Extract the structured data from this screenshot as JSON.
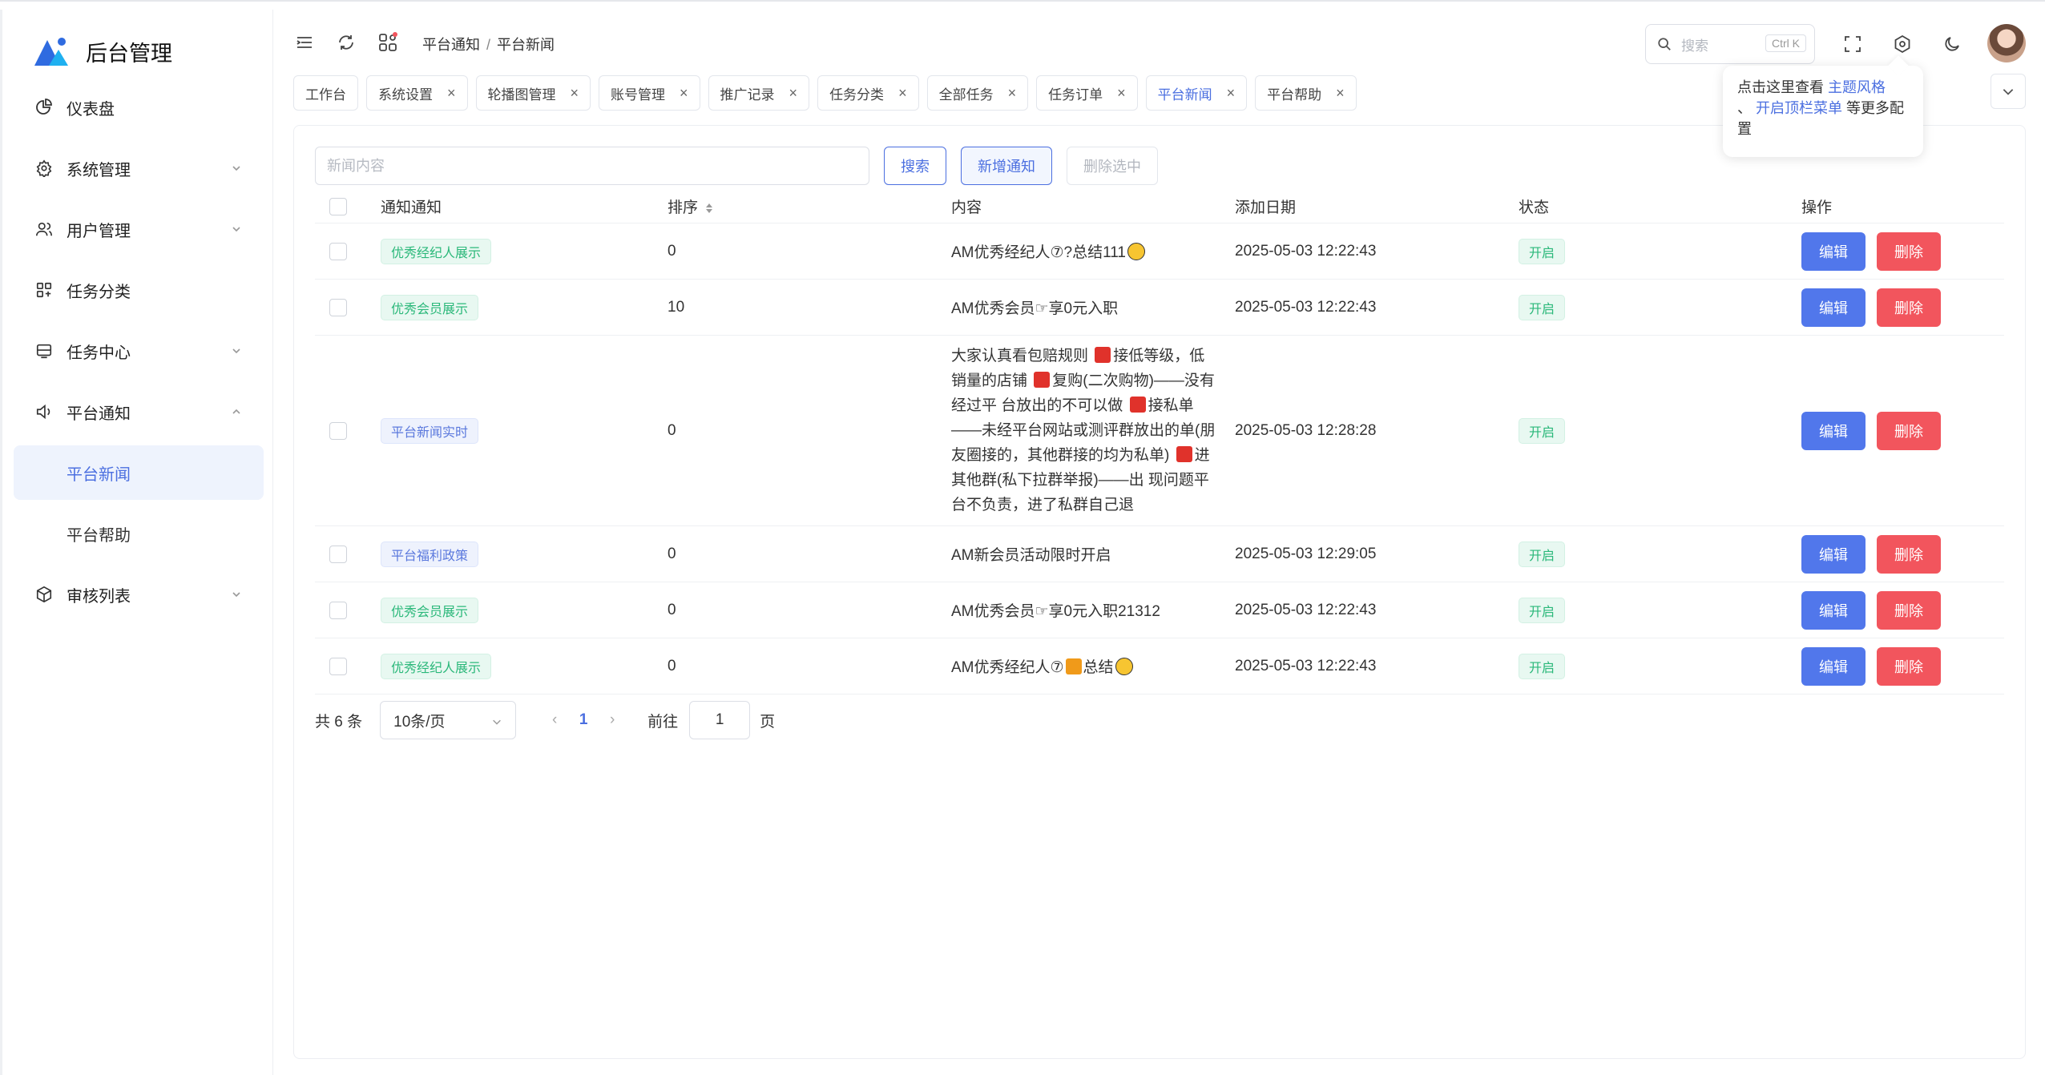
{
  "app": {
    "title": "后台管理",
    "brand_color": "#2f6be0"
  },
  "sidebar": {
    "items": [
      {
        "label": "仪表盘",
        "icon": "pie-chart-icon",
        "has_children": false
      },
      {
        "label": "系统管理",
        "icon": "gear-icon",
        "has_children": true,
        "expanded": false
      },
      {
        "label": "用户管理",
        "icon": "users-icon",
        "has_children": true,
        "expanded": false
      },
      {
        "label": "任务分类",
        "icon": "grid-icon",
        "has_children": false
      },
      {
        "label": "任务中心",
        "icon": "task-center-icon",
        "has_children": true,
        "expanded": false
      },
      {
        "label": "平台通知",
        "icon": "speaker-icon",
        "has_children": true,
        "expanded": true,
        "children": [
          {
            "label": "平台新闻",
            "active": true
          },
          {
            "label": "平台帮助",
            "active": false
          }
        ]
      },
      {
        "label": "审核列表",
        "icon": "box-icon",
        "has_children": true,
        "expanded": false
      }
    ]
  },
  "header": {
    "breadcrumb": [
      "平台通知",
      "平台新闻"
    ],
    "search_placeholder": "搜索",
    "search_shortcut": "Ctrl K"
  },
  "tabs": [
    {
      "label": "工作台",
      "closable": false,
      "active": false
    },
    {
      "label": "系统设置",
      "closable": true,
      "active": false
    },
    {
      "label": "轮播图管理",
      "closable": true,
      "active": false
    },
    {
      "label": "账号管理",
      "closable": true,
      "active": false
    },
    {
      "label": "推广记录",
      "closable": true,
      "active": false
    },
    {
      "label": "任务分类",
      "closable": true,
      "active": false
    },
    {
      "label": "全部任务",
      "closable": true,
      "active": false
    },
    {
      "label": "任务订单",
      "closable": true,
      "active": false
    },
    {
      "label": "平台新闻",
      "closable": true,
      "active": true
    },
    {
      "label": "平台帮助",
      "closable": true,
      "active": false
    }
  ],
  "tooltip": {
    "prefix": "点击这里查看 ",
    "link1": "主题风格",
    "middle": "、 ",
    "link2": "开启顶栏菜单",
    "suffix": " 等更多配置"
  },
  "toolbar": {
    "input_placeholder": "新闻内容",
    "search_label": "搜索",
    "add_label": "新增通知",
    "delete_label": "删除选中"
  },
  "table": {
    "columns": [
      "通知通知",
      "排序",
      "内容",
      "添加日期",
      "状态",
      "操作"
    ],
    "edit_label": "编辑",
    "delete_label": "删除",
    "rows": [
      {
        "tag": "优秀经纪人展示",
        "tag_color": "green",
        "sort": "0",
        "content": "AM优秀经纪人⑦?总结111",
        "content_end_emoji": "face",
        "date": "2025-05-03 12:22:43",
        "status": "开启"
      },
      {
        "tag": "优秀会员展示",
        "tag_color": "green",
        "sort": "10",
        "content": "AM优秀会员☞享0元入职",
        "date": "2025-05-03 12:22:43",
        "status": "开启"
      },
      {
        "tag": "平台新闻实时",
        "tag_color": "blue",
        "sort": "0",
        "content_parts": [
          "大家认真看包赔规则 ",
          "接低等级，低销量的店铺 ",
          "复购(二次购物)——没有经过平 台放出的不可以做 ",
          "接私单——未经平台网站或测评群放出的单(朋友圈接的，其他群接的均为私单) ",
          "进其他群(私下拉群举报)——出 现问题平台不负责，进了私群自己退"
        ],
        "date": "2025-05-03 12:28:28",
        "status": "开启"
      },
      {
        "tag": "平台福利政策",
        "tag_color": "blue",
        "sort": "0",
        "content": "AM新会员活动限时开启",
        "date": "2025-05-03 12:29:05",
        "status": "开启"
      },
      {
        "tag": "优秀会员展示",
        "tag_color": "green",
        "sort": "0",
        "content": "AM优秀会员☞享0元入职21312",
        "date": "2025-05-03 12:22:43",
        "status": "开启"
      },
      {
        "tag": "优秀经纪人展示",
        "tag_color": "green",
        "sort": "0",
        "content_a": "AM优秀经纪人⑦",
        "content_b": "总结",
        "date": "2025-05-03 12:22:43",
        "status": "开启"
      }
    ]
  },
  "pagination": {
    "total": "共 6 条",
    "page_size": "10条/页",
    "current_page": "1",
    "goto_label": "前往",
    "goto_value": "1",
    "page_unit": "页"
  }
}
